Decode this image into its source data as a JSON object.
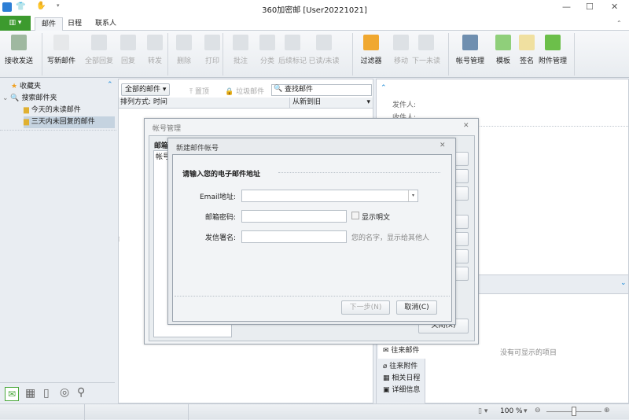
{
  "window": {
    "title": "360加密邮 [User20221021]",
    "minimize": "—",
    "maximize": "☐",
    "close": "✕"
  },
  "tabs": [
    "邮件",
    "日程",
    "联系人"
  ],
  "ribbon": [
    {
      "label": "接收发送",
      "disabled": false,
      "color": "#9fb8a0"
    },
    {
      "label": "写新邮件",
      "disabled": false,
      "color": "#e6e8ea"
    },
    {
      "label": "全部回复",
      "disabled": true
    },
    {
      "label": "回复",
      "disabled": true
    },
    {
      "label": "转发",
      "disabled": true
    },
    {
      "label": "删除",
      "disabled": true
    },
    {
      "label": "打印",
      "disabled": true
    },
    {
      "label": "批注",
      "disabled": true
    },
    {
      "label": "分类",
      "disabled": true
    },
    {
      "label": "后续标记",
      "disabled": true
    },
    {
      "label": "已读/未读",
      "disabled": true
    },
    {
      "label": "过滤器",
      "disabled": false,
      "color": "#f0a830"
    },
    {
      "label": "移动",
      "disabled": true
    },
    {
      "label": "下一未读",
      "disabled": true
    },
    {
      "label": "帐号管理",
      "disabled": false,
      "color": "#6f8fb0"
    },
    {
      "label": "模板",
      "disabled": false,
      "color": "#8fcf7a"
    },
    {
      "label": "签名",
      "disabled": false,
      "color": "#f0e0a0"
    },
    {
      "label": "附件管理",
      "disabled": false,
      "color": "#6cbf4a"
    }
  ],
  "sidebar": {
    "favorites": "收藏夹",
    "search_folders": "搜索邮件夹",
    "items": [
      "今天的未读邮件",
      "三天内未回复的邮件"
    ]
  },
  "list": {
    "filter": "全部的邮件",
    "pin": "置顶",
    "junk": "垃圾邮件",
    "search_placeholder": "查找邮件",
    "sort_label": "排列方式: 时间",
    "sort_order": "从新到旧"
  },
  "preview": {
    "from": "发件人:",
    "to": "收件人:",
    "empty": "没有可显示的项目",
    "tabs": [
      "往来邮件",
      "往来附件",
      "相关日程",
      "详细信息"
    ]
  },
  "account_dialog": {
    "title": "帐号管理",
    "group": "邮箱",
    "column": "帐号",
    "close_btn": "关闭(X)"
  },
  "new_account": {
    "title": "新建邮件帐号",
    "heading": "请输入您的电子邮件地址",
    "email_label": "Email地址:",
    "email_value": "",
    "password_label": "邮箱密码:",
    "password_value": "",
    "show_plain": "显示明文",
    "signature_label": "发信署名:",
    "signature_value": "",
    "signature_hint": "您的名字，显示给其他人",
    "next": "下一步(N)",
    "cancel": "取消(C)"
  },
  "status": {
    "zoom": "100 %"
  }
}
